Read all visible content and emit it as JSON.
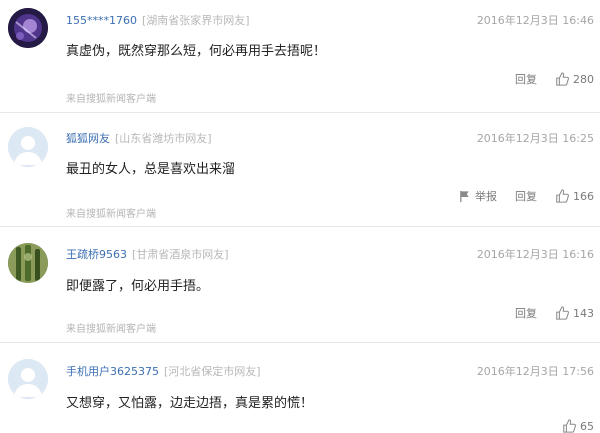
{
  "comments": [
    {
      "username": "155****1760",
      "location": "[湖南省张家界市网友]",
      "time": "2016年12月3日 16:46",
      "text": "真虚伪，既然穿那么短，何必再用手去捂呢！",
      "source": "来自搜狐新闻客户端",
      "reply_label": "回复",
      "likes": "280",
      "avatar_icon": "galaxy-avatar"
    },
    {
      "username": "狐狐网友",
      "location": "[山东省潍坊市网友]",
      "time": "2016年12月3日 16:25",
      "text": "最丑的女人，总是喜欢出来溜",
      "source": "来自搜狐新闻客户端",
      "report_label": "举报",
      "reply_label": "回复",
      "likes": "166",
      "avatar_icon": "default-user-avatar"
    },
    {
      "username": "王疏桥9563",
      "location": "[甘肃省酒泉市网友]",
      "time": "2016年12月3日 16:16",
      "text": "即便露了，何必用手捂。",
      "source": "来自搜狐新闻客户端",
      "reply_label": "回复",
      "likes": "143",
      "avatar_icon": "plant-avatar"
    },
    {
      "username": "手机用户3625375",
      "location": "[河北省保定市网友]",
      "time": "2016年12月3日 17:56",
      "text": "又想穿，又怕露，边走边捂，真是累的慌！",
      "likes": "65",
      "avatar_icon": "default-user-avatar"
    }
  ],
  "colors": {
    "username": "#3c6fb3",
    "meta": "#a6a6a6",
    "divider": "#e8e8e8"
  }
}
